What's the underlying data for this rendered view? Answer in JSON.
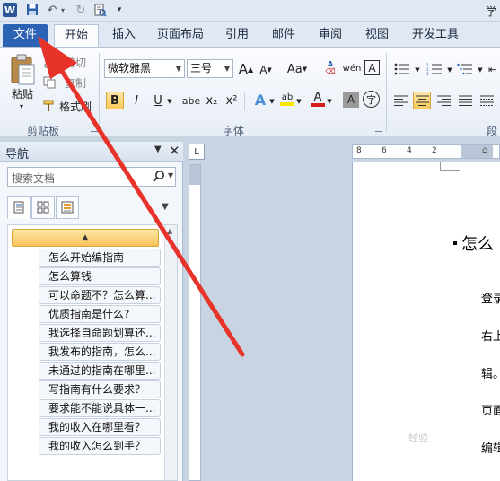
{
  "title_bar": {
    "title_fragment": "学",
    "quick_access": {
      "word_icon": "word-app-icon",
      "save_icon": "save-icon",
      "undo_icon": "undo-icon",
      "redo_icon": "redo-icon",
      "print_icon": "print-preview-icon",
      "customize_icon": "customize-toolbar-icon"
    }
  },
  "ribbon_tabs": [
    "文件",
    "开始",
    "插入",
    "页面布局",
    "引用",
    "邮件",
    "审阅",
    "视图",
    "开发工具"
  ],
  "clipboard": {
    "paste_label": "粘贴",
    "cut_label": "剪切",
    "copy_label": "复制",
    "format_painter_label": "格式刷",
    "group_label": "剪贴板"
  },
  "font": {
    "font_name": "微软雅黑",
    "font_size": "三号",
    "grow_label": "A",
    "shrink_label": "A",
    "case_label": "Aa",
    "wen_label": "wén",
    "border_char_label": "A",
    "bold_label": "B",
    "italic_label": "I",
    "underline_label": "U",
    "strike_label": "abe",
    "subscript_label": "x₂",
    "superscript_label": "x²",
    "effects_label": "A",
    "highlight_label": "ab",
    "font_color_label": "A",
    "shading_label": "A",
    "enclose_label": "字",
    "group_label": "字体"
  },
  "paragraph": {
    "group_label": "段"
  },
  "colors": {
    "file_tab": "#2b62b4",
    "active_button": "#f8c957",
    "font_color_bar": "#d51f1f",
    "highlight_bar": "#f6e600",
    "arrow": "#e8332b"
  },
  "nav_pane": {
    "title": "导航",
    "search_placeholder": "搜索文档",
    "headings": [
      "怎么开始编指南",
      "怎么算钱",
      "可以命题不？怎么算...",
      "优质指南是什么?",
      "我选择自命题划算还...",
      "我发布的指南，怎么...",
      "未通过的指南在哪里...",
      "写指南有什么要求？",
      "要求能不能说具体一...",
      "我的收入在哪里看？",
      "我的收入怎么到手？"
    ]
  },
  "ruler": {
    "corner_symbol": "L",
    "ticks": [
      "8",
      "6",
      "4",
      "2"
    ]
  },
  "document": {
    "heading": "怎么",
    "lines": [
      "登录",
      "右上",
      "辑。",
      "页面",
      "编辑"
    ]
  },
  "watermark": "经验"
}
